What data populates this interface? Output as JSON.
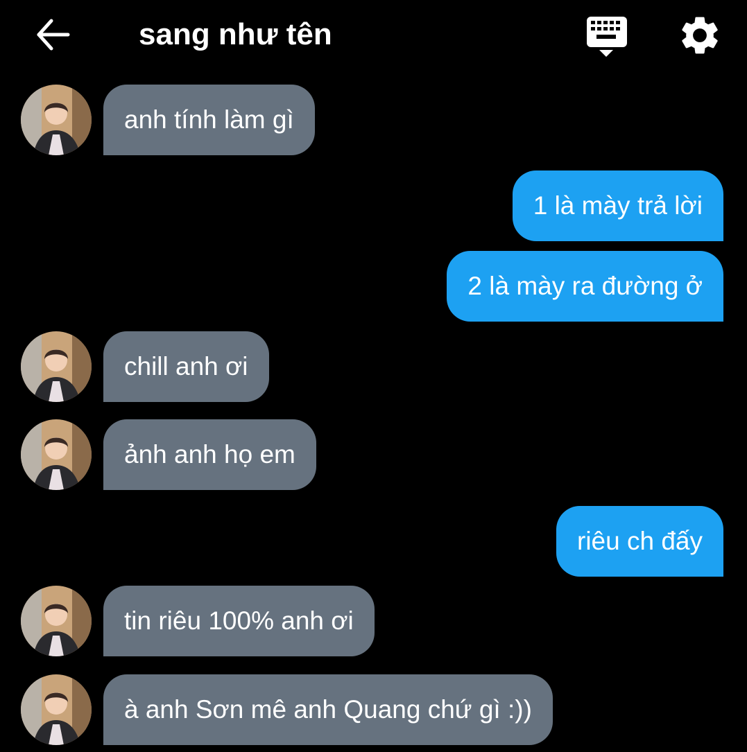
{
  "header": {
    "title": "sang như tên",
    "back_icon": "arrow-left-icon",
    "keyboard_icon": "keyboard-icon",
    "settings_icon": "gear-icon"
  },
  "colors": {
    "background": "#000000",
    "incoming_bubble": "#66727f",
    "outgoing_bubble": "#1da1f2",
    "text": "#ffffff"
  },
  "messages": [
    {
      "direction": "incoming",
      "text": "anh tính làm gì"
    },
    {
      "direction": "outgoing",
      "text": "1 là mày trả lời"
    },
    {
      "direction": "outgoing",
      "text": "2 là mày ra đường ở"
    },
    {
      "direction": "incoming",
      "text": "chill anh ơi"
    },
    {
      "direction": "incoming",
      "text": "ảnh anh họ em"
    },
    {
      "direction": "outgoing",
      "text": "riêu ch đấy"
    },
    {
      "direction": "incoming",
      "text": "tin riêu 100% anh ơi"
    },
    {
      "direction": "incoming",
      "text": "à anh Sơn mê anh Quang chứ gì :))"
    }
  ]
}
